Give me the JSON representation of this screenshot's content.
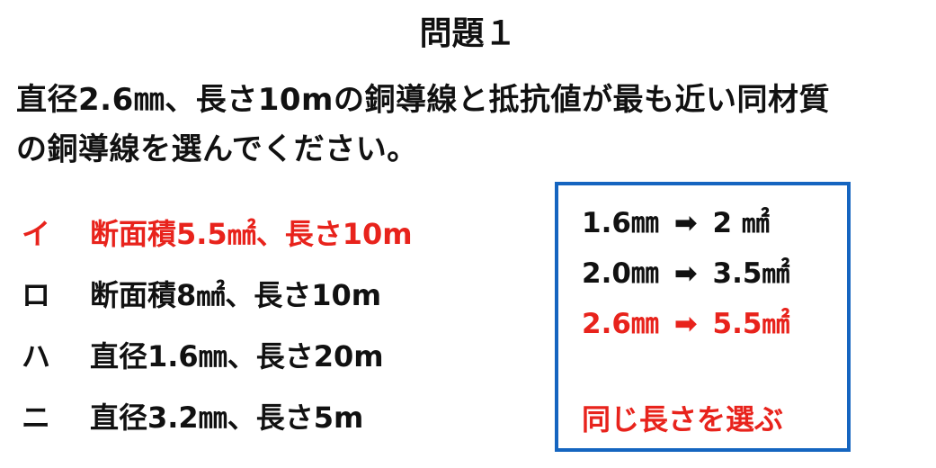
{
  "title": "問題１",
  "question": {
    "line1": "直径2.6㎜、長さ10mの銅導線と抵抗値が最も近い同材質",
    "line2": "の銅導線を選んでください。"
  },
  "options": [
    {
      "marker": "イ",
      "text": "断面積5.5㎟、長さ10m",
      "highlight": true
    },
    {
      "marker": "ロ",
      "text": "断面積8㎟、長さ10m",
      "highlight": false
    },
    {
      "marker": "ハ",
      "text": "直径1.6㎜、長さ20m",
      "highlight": false
    },
    {
      "marker": "ニ",
      "text": "直径3.2㎜、長さ5m",
      "highlight": false
    }
  ],
  "hint": {
    "rows": [
      {
        "from": "1.6㎜",
        "arrow": "➡",
        "to": "2 ㎟",
        "highlight": false
      },
      {
        "from": "2.0㎜",
        "arrow": "➡",
        "to": "3.5㎟",
        "highlight": false
      },
      {
        "from": "2.6㎜",
        "arrow": "➡",
        "to": "5.5㎟",
        "highlight": true
      }
    ],
    "note": "同じ長さを選ぶ"
  },
  "colors": {
    "accent_red": "#e8231c",
    "box_border_blue": "#1565c0",
    "text": "#111111"
  }
}
